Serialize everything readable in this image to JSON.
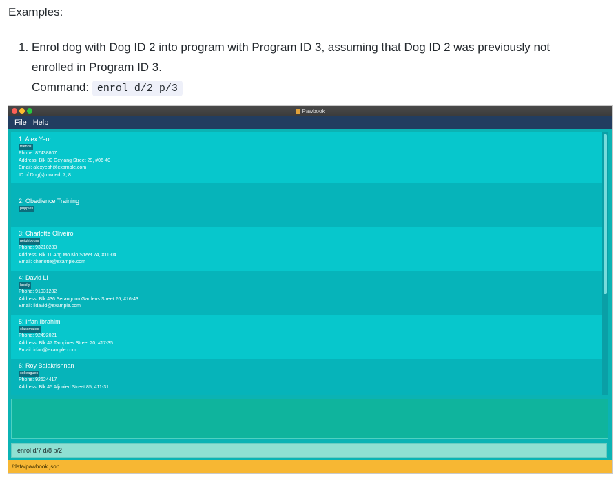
{
  "doc": {
    "heading": "Examples:",
    "item_number": "1.",
    "item_line1": "Enrol dog with Dog ID 2 into program with Program ID 3, assuming that Dog ID 2 was previously not",
    "item_line2": "enrolled in Program ID 3.",
    "command_label": "Command:",
    "command_code": "enrol d/2 p/3"
  },
  "app": {
    "window_title": "Pawbook",
    "menu": [
      "File",
      "Help"
    ],
    "cards": [
      {
        "title": "1:  Alex Yeoh",
        "tag": "friends",
        "lines": [
          "Phone: 87438807",
          "Address: Blk 30 Geylang Street 29, #06-40",
          "Email: alexyeoh@example.com",
          "ID of Dog(s) owned: 7, 8"
        ]
      },
      {
        "title": "2:  Obedience Training",
        "tag": "puppies",
        "lines": []
      },
      {
        "title": "3:  Charlotte Oliveiro",
        "tag": "neighbours",
        "lines": [
          "Phone: 93210283",
          "Address: Blk 11 Ang Mo Kio Street 74, #11-04",
          "Email: charlotte@example.com"
        ]
      },
      {
        "title": "4:  David Li",
        "tag": "family",
        "lines": [
          "Phone: 91031282",
          "Address: Blk 436 Serangoon Gardens Street 26, #16-43",
          "Email: lidavid@example.com"
        ]
      },
      {
        "title": "5:  Irfan Ibrahim",
        "tag": "classmates",
        "lines": [
          "Phone: 92492021",
          "Address: Blk 47 Tampines Street 20, #17-35",
          "Email: irfan@example.com"
        ]
      },
      {
        "title": "6:  Roy Balakrishnan",
        "tag": "colleagues",
        "lines": [
          "Phone: 92624417",
          "Address: Blk 45 Aljunied Street 85, #11-31"
        ]
      }
    ],
    "result_text": "",
    "command_input": "enrol d/7 d/8 p/2",
    "status_path": "./data/pawbook.json",
    "colors": {
      "menubar": "#223d60",
      "card_light": "#07c7cc",
      "card_dark": "#06b4ba",
      "status_bar": "#f7b733"
    }
  }
}
